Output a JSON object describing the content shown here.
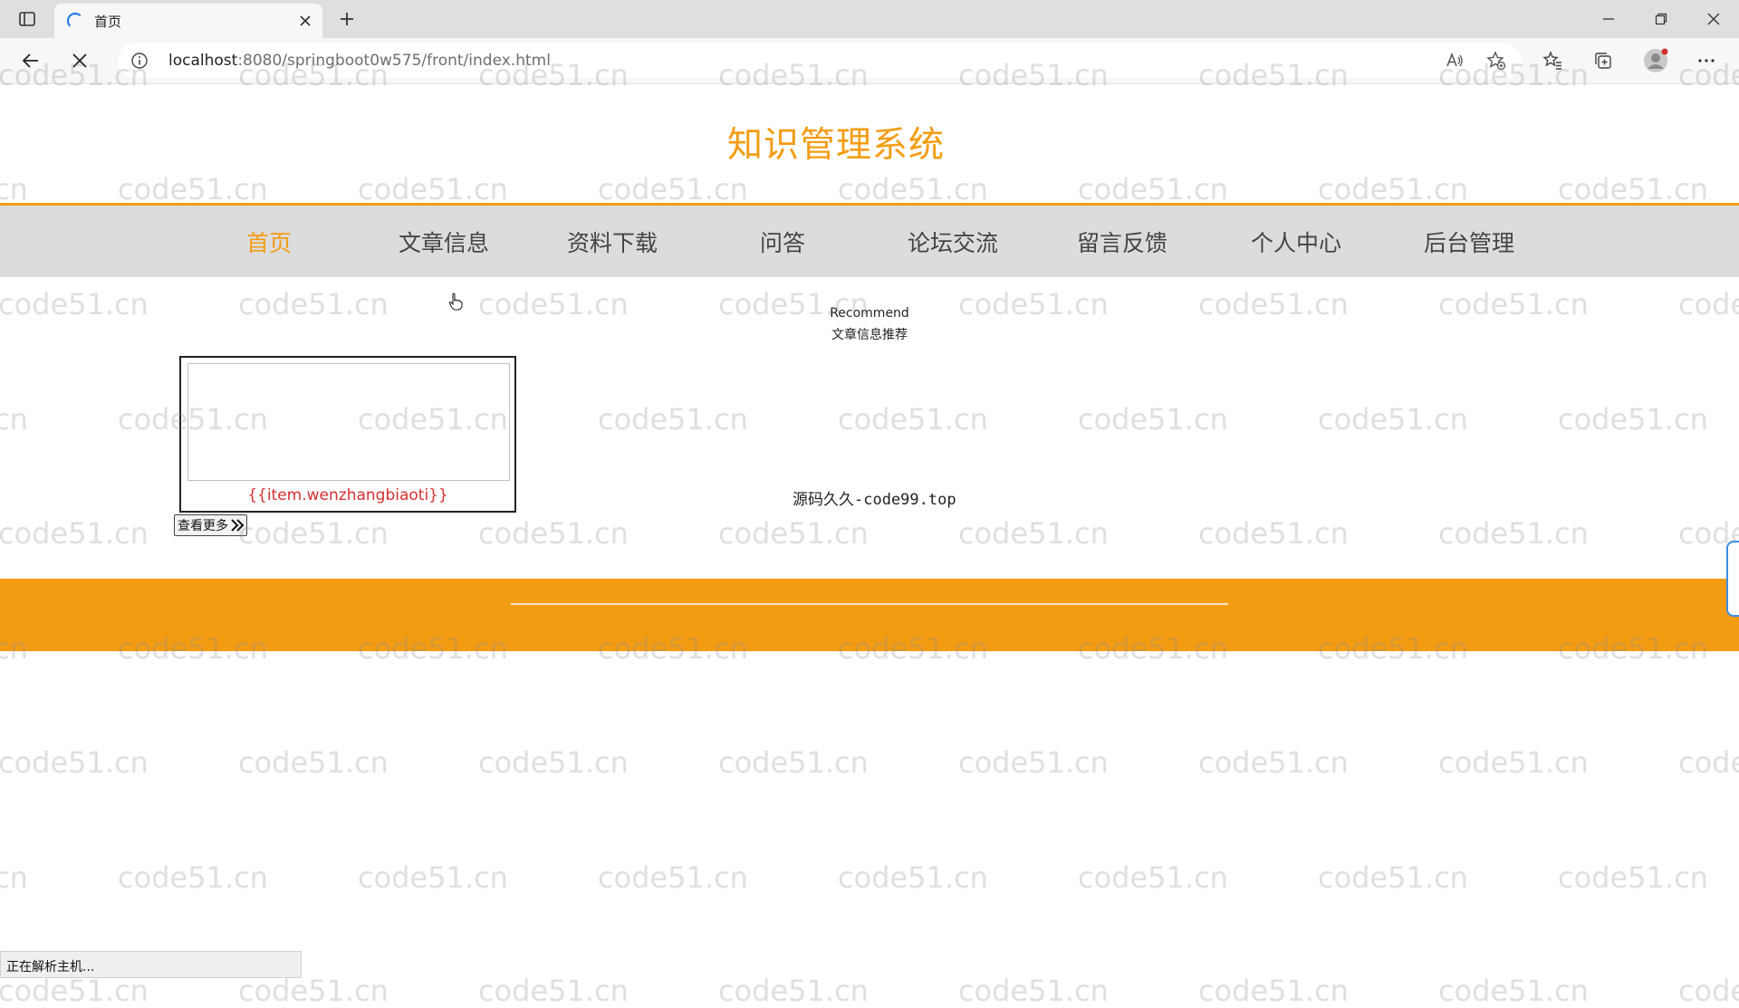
{
  "browser": {
    "tab": {
      "title": "首页"
    },
    "url": {
      "host": "localhost",
      "rest": ":8080/springboot0w575/front/index.html"
    },
    "status": "正在解析主机..."
  },
  "site": {
    "title": "知识管理系统",
    "nav": [
      {
        "label": "首页",
        "active": true
      },
      {
        "label": "文章信息"
      },
      {
        "label": "资料下载"
      },
      {
        "label": "问答"
      },
      {
        "label": "论坛交流"
      },
      {
        "label": "留言反馈"
      },
      {
        "label": "个人中心"
      },
      {
        "label": "后台管理"
      }
    ]
  },
  "recommend": {
    "title_en": "Recommend",
    "title_cn": "文章信息推荐",
    "card_title": "{{item.wenzhangbiaoti}}",
    "more_label": "查看更多"
  },
  "source_text": "源码久久-code99.top",
  "watermark": "code51.cn",
  "colors": {
    "accent": "#f39c12",
    "nav_bg": "#dcdcdc",
    "card_title": "#d43030"
  }
}
